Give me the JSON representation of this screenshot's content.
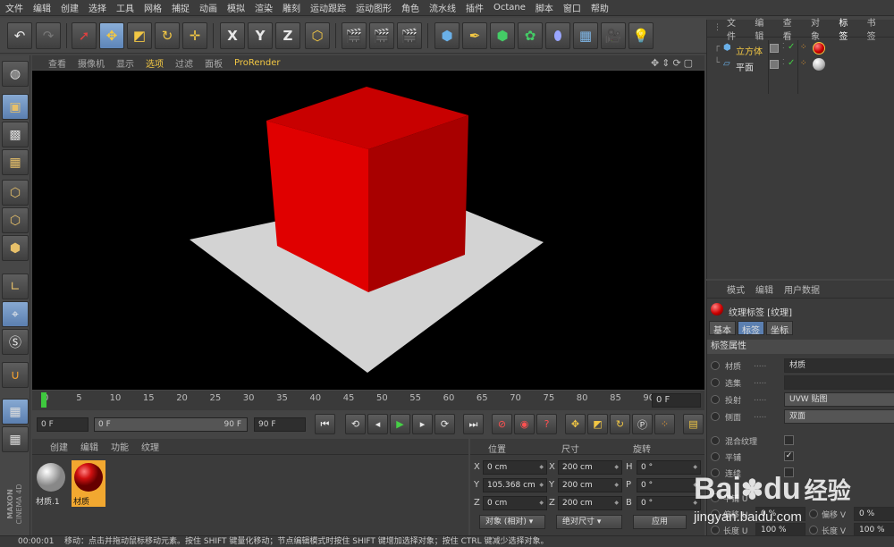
{
  "menu": [
    "文件",
    "编辑",
    "创建",
    "选择",
    "工具",
    "网格",
    "捕捉",
    "动画",
    "模拟",
    "渲染",
    "雕刻",
    "运动跟踪",
    "运动图形",
    "角色",
    "流水线",
    "插件",
    "Octane",
    "脚本",
    "窗口",
    "帮助"
  ],
  "viewport_menu": [
    "查看",
    "摄像机",
    "显示",
    "选项",
    "过滤",
    "面板",
    "ProRender"
  ],
  "axis_buttons": [
    "X",
    "Y",
    "Z"
  ],
  "timeline": {
    "ticks": [
      "0",
      "5",
      "10",
      "15",
      "20",
      "25",
      "30",
      "35",
      "40",
      "45",
      "50",
      "55",
      "60",
      "65",
      "70",
      "75",
      "80",
      "85",
      "90"
    ],
    "current_frame": "0 F"
  },
  "transport": {
    "start_field": "0 F",
    "range_start": "0 F",
    "range_end": "90 F",
    "end_field": "90 F"
  },
  "material_tabs": [
    "创建",
    "编辑",
    "功能",
    "纹理"
  ],
  "materials": [
    {
      "name": "材质.1",
      "color": "#d8d8d8"
    },
    {
      "name": "材质",
      "color": "#d01010",
      "selected": true
    }
  ],
  "coords": {
    "headers": [
      "位置",
      "尺寸",
      "旋转"
    ],
    "rows": [
      {
        "axis": "X",
        "pos": "0 cm",
        "size_axis": "X",
        "size": "200 cm",
        "rot_axis": "H",
        "rot": "0 °"
      },
      {
        "axis": "Y",
        "pos": "105.368 cm",
        "size_axis": "Y",
        "size": "200 cm",
        "rot_axis": "P",
        "rot": "0 °"
      },
      {
        "axis": "Z",
        "pos": "0 cm",
        "size_axis": "Z",
        "size": "200 cm",
        "rot_axis": "B",
        "rot": "0 °"
      }
    ],
    "mode": "对象 (相对)",
    "size_mode": "绝对尺寸",
    "apply": "应用"
  },
  "object_tabs": [
    "文件",
    "编辑",
    "查看",
    "对象",
    "标签",
    "书签"
  ],
  "objects": [
    {
      "name": "立方体",
      "tag_color": "#d01010",
      "selected": true
    },
    {
      "name": "平面",
      "tag_color": "#dddddd"
    }
  ],
  "attr_tabs": [
    "模式",
    "编辑",
    "用户数据"
  ],
  "attr": {
    "title": "纹理标签 [纹理]",
    "subtabs": [
      "基本",
      "标签",
      "坐标"
    ],
    "section": "标签属性",
    "rows": [
      {
        "label": "材质",
        "value": "材质"
      },
      {
        "label": "选集",
        "value": ""
      },
      {
        "label": "投射",
        "value": "UVW 贴图"
      },
      {
        "label": "侧面",
        "value": "双面"
      }
    ],
    "checks": [
      {
        "label": "混合纹理",
        "checked": false
      },
      {
        "label": "平铺",
        "checked": true
      },
      {
        "label": "连续",
        "checked": false
      }
    ],
    "offset": {
      "u_label": "偏移 U",
      "u_value": "0 %",
      "v_label": "偏移 V",
      "v_value": "0 %"
    },
    "length": {
      "u_label": "长度 U",
      "u_value": "100 %",
      "v_label": "长度 V",
      "v_value": "100 %"
    },
    "tiles_label": "平铺 U"
  },
  "branding": {
    "maxon": "MAXON",
    "cinema": "CINEMA 4D"
  },
  "status": {
    "time": "00:00:01",
    "message": "移动：点击并拖动鼠标移动元素。按住 SHIFT 键量化移动；节点编辑模式时按住 SHIFT 键增加选择对象；按住 CTRL 键减少选择对象。"
  },
  "watermark": {
    "brand": "Bai",
    "du": "du",
    "suffix": "经验",
    "url": "jingyan.baidu.com"
  },
  "colors": {
    "cube": "#c40000",
    "accent": "#f2c744",
    "select": "#5b7fb0"
  }
}
